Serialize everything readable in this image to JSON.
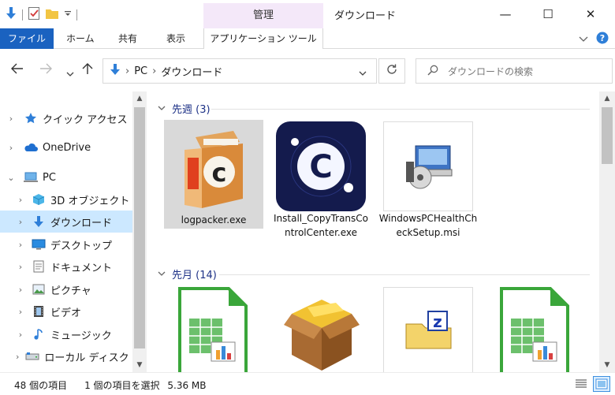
{
  "window": {
    "title": "ダウンロード",
    "context_tab": "管理",
    "minimize": "—",
    "maximize": "☐",
    "close": "✕"
  },
  "ribbon": {
    "tabs": [
      "ファイル",
      "ホーム",
      "共有",
      "表示",
      "アプリケーション ツール"
    ],
    "accent_color": "#1a62c0",
    "context_color": "#f4e8f9"
  },
  "address": {
    "segments": [
      "PC",
      "ダウンロード"
    ],
    "separator": "›"
  },
  "search": {
    "placeholder": "ダウンロードの検索"
  },
  "nav": {
    "items": [
      {
        "label": "クイック アクセス",
        "icon": "star-icon",
        "chevron": "›"
      },
      {
        "label": "OneDrive",
        "icon": "cloud-icon",
        "chevron": "›"
      },
      {
        "label": "PC",
        "icon": "pc-icon",
        "chevron": "⌄"
      },
      {
        "label": "3D オブジェクト",
        "icon": "cube-icon",
        "chevron": "›"
      },
      {
        "label": "ダウンロード",
        "icon": "download-arrow-icon",
        "chevron": "›"
      },
      {
        "label": "デスクトップ",
        "icon": "desktop-icon",
        "chevron": "›"
      },
      {
        "label": "ドキュメント",
        "icon": "document-icon",
        "chevron": "›"
      },
      {
        "label": "ピクチャ",
        "icon": "picture-icon",
        "chevron": "›"
      },
      {
        "label": "ビデオ",
        "icon": "video-icon",
        "chevron": "›"
      },
      {
        "label": "ミュージック",
        "icon": "music-icon",
        "chevron": "›"
      },
      {
        "label": "ローカル ディスク (C",
        "icon": "disk-icon",
        "chevron": "›"
      }
    ]
  },
  "groups": [
    {
      "header": "先週 (3)",
      "files": [
        {
          "name": "logpacker.exe",
          "icon": "installer-box-c-icon"
        },
        {
          "name": "Install_CopyTransControlCenter.exe",
          "icon": "copytrans-icon"
        },
        {
          "name": "WindowsPCHealthCheckSetup.msi",
          "icon": "msi-installer-icon"
        }
      ]
    },
    {
      "header": "先月 (14)",
      "files": [
        {
          "name": "",
          "icon": "spreadsheet-icon"
        },
        {
          "name": "",
          "icon": "package-box-icon"
        },
        {
          "name": "",
          "icon": "zip-folder-icon"
        },
        {
          "name": "",
          "icon": "spreadsheet-icon"
        }
      ]
    }
  ],
  "status": {
    "count": "48 個の項目",
    "selection": "1 個の項目を選択",
    "size": "5.36 MB"
  }
}
